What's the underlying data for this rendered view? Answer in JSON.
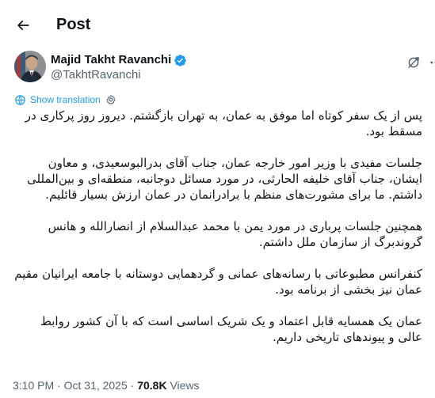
{
  "header": {
    "title": "Post"
  },
  "author": {
    "display_name": "Majid Takht Ravanchi",
    "handle": "@TakhtRavanchi"
  },
  "translate": {
    "label": "Show translation"
  },
  "tweet": {
    "paragraphs": [
      "پس از یک سفر کوتاه اما موفق به عمان، به تهران بازگشتم. دیروز روز پرکاری در مسقط بود.",
      "جلسات مفیدی با وزیر امور خارجه عمان، جناب آقای بدرالبوسعیدی، و معاون ایشان، جناب آقای خلیفه الحارثی، در مورد مسائل دوجانبه، منطقه‌ای و بین‌المللی داشتم. ما برای مشورت‌های منظم با برادرانمان در عمان ارزش بسیار قائلیم.",
      "همچنین جلسات پرباری در مورد یمن با محمد عبدالسلام از انصارالله و هانس گروندبرگ از سازمان ملل داشتم.",
      "کنفرانس مطبوعاتی با رسانه‌های عمانی و گردهمایی دوستانه با جامعه ایرانیان مقیم عمان نیز بخشی از برنامه بود.",
      "عمان یک همسایه قابل اعتماد و یک شریک اساسی است که با آن کشور روابط عالی و پیوندهای تاریخی داریم."
    ]
  },
  "meta": {
    "time": "3:10 PM",
    "separator": " · ",
    "date": "Oct 31, 2025",
    "views_count": "70.8K",
    "views_label": " Views"
  },
  "colors": {
    "accent": "#1d9bf0",
    "text_primary": "#0f1419",
    "text_secondary": "#536471"
  },
  "icons": {
    "back": "arrow-left-icon",
    "verified": "verified-badge-icon",
    "grok": "grok-icon",
    "more": "more-dots-icon",
    "translate": "globe-icon",
    "settings": "gear-icon"
  }
}
